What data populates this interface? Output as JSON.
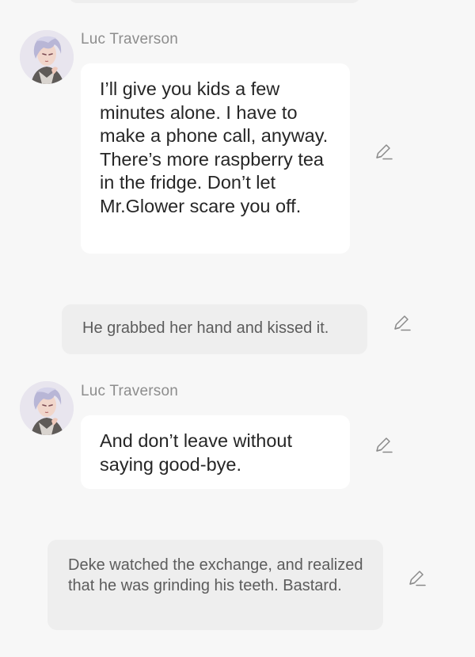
{
  "messages": [
    {
      "type": "dialogue",
      "speaker": "Luc Traverson",
      "text": "I’ll give you kids a few minutes alone. I have to make a phone call, anyway. There’s more raspberry tea in the fridge. Don’t let Mr.Glower scare you off."
    },
    {
      "type": "narration",
      "text": "He grabbed her hand and kissed it."
    },
    {
      "type": "dialogue",
      "speaker": "Luc Traverson",
      "text": "And don’t leave without saying good-bye."
    },
    {
      "type": "narration",
      "text": "Deke watched the exchange, and realized that he was grinding his teeth. Bastard."
    }
  ],
  "icons": {
    "edit": "pencil-edit-icon",
    "avatar": "character-portrait"
  },
  "colors": {
    "background": "#f7f7f7",
    "dialogue_bubble": "#ffffff",
    "narration_bubble": "#eeeeee",
    "speaker_name": "#8d8d8d",
    "dialogue_text": "#262626",
    "narration_text": "#5c5c5c",
    "icon": "#8a8a8a"
  }
}
